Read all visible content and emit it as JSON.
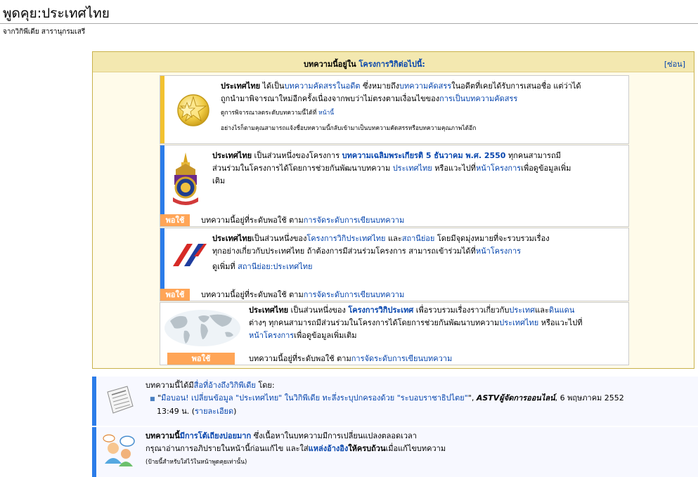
{
  "page": {
    "title": "พูดคุย:ประเทศไทย",
    "tagline": "จากวิกิพีเดีย สารานุกรมเสรี"
  },
  "projects": {
    "header_prefix": "บทความนี้อยู่ใน ",
    "header_link": "โครงการวิกิต่อไปนี้:",
    "hide_label": "[ซ่อน]"
  },
  "former_fa": {
    "subject": "ประเทศไทย",
    "t1": " ได้เป็น",
    "l1": "บทความคัดสรรในอดีต",
    "t2": " ซึ่งหมายถึง",
    "l2": "บทความคัดสรร",
    "t3": "ในอดีตที่เคยได้รับการเสนอชื่อ แต่ว่าได้",
    "line2_text": "ถูกนำมาพิจารณาใหม่อีกครั้งเนื่องจากพบว่าไม่ตรงตามเงื่อนไขของ",
    "line2_link": "การเป็นบทความคัดสรร",
    "note1_text": "ดูการพิจารณาลดระดับบทความนี้ได้ที่ ",
    "note1_link": "หน้านี้",
    "note2": "อย่างไรก็ตามคุณสามารถแจ้งชื่อบทความนี้กลับเข้ามาเป็นบทความคัดสรรหรือบทความคุณภาพได้อีก"
  },
  "king_project": {
    "subject": "ประเทศไทย",
    "t1": " เป็นส่วนหนึ่งของโครงการ ",
    "l1": "บทความเฉลิมพระเกียรติ 5 ธันวาคม พ.ศ. 2550",
    "t2": " ทุกคนสามารถมี",
    "line2_t": "ส่วนร่วมในโครงการได้โดยการช่วยกันพัฒนาบทความ ",
    "line2_l": "ประเทศไทย",
    "line2_t2": " หรือแวะไปที่",
    "line2_l2": "หน้าโครงการ",
    "line2_t3": "เพื่อดูข้อมูลเพิ่ม",
    "line3": "เติม",
    "rating": "พอใช้",
    "rating_t": "บทความนี้อยู่ที่ระดับพอใช้ ตาม",
    "rating_l": "การจัดระดับการเขียนบทความ"
  },
  "thai_project": {
    "subject": "ประเทศไทย",
    "t1": "เป็นส่วนหนึ่งของ",
    "l1": "โครงการวิกิประเทศไทย",
    "t2": " และ",
    "l2": "สถานีย่อย",
    "t3": " โดยมีจุดมุ่งหมายที่จะรวบรวมเรื่อง",
    "line2_t": "ทุกอย่างเกี่ยวกับประเทศไทย ถ้าต้องการมีส่วนร่วมโครงการ สามารถเข้าร่วมได้ที่",
    "line2_l": "หน้าโครงการ",
    "line3_t": "ดูเพิ่มที่ ",
    "line3_l": "สถานีย่อย:ประเทศไทย",
    "rating": "พอใช้",
    "rating_t": "บทความนี้อยู่ที่ระดับพอใช้ ตาม",
    "rating_l": "การจัดระดับการเขียนบทความ"
  },
  "country_project": {
    "subject": "ประเทศไทย",
    "t1": " เป็นส่วนหนึ่งของ ",
    "l1": "โครงการวิกิประเทศ",
    "t2": " เพื่อรวบรวมเรื่องราวเกี่ยวกับ",
    "l2": "ประเทศ",
    "t3": "และ",
    "l3": "ดินแดน",
    "line2_t": "ต่างๆ ทุกคนสามารถมีส่วนร่วมในโครงการได้โดยการช่วยกันพัฒนาบทความ",
    "line2_l": "ประเทศไทย",
    "line2_t2": " หรือแวะไปที่",
    "line3_l": "หน้าโครงการ",
    "line3_t": "เพื่อดูข้อมูลเพิ่มเติม",
    "rating": "พอใช้",
    "rating_t": "บทความนี้อยู่ที่ระดับพอใช้ ตาม",
    "rating_l": "การจัดระดับการเขียนบทความ"
  },
  "media": {
    "t1": "บทความนี้ได้มี",
    "l1": "สื่อที่อ้างถึงวิกิพีเดีย",
    "t2": " โดย:",
    "bullet": "■",
    "q1": "\"",
    "l2": "มือบอน! เปลี่ยนข้อมูล \"ประเทศไทย\" ในวิกิพีเดีย ทะลึ่งระบุปกครองด้วย \"ระบอบราชาธิปไตย\"",
    "q2": "\", ",
    "source": "ASTVผู้จัดการออนไลน์",
    "date": ", 6 พฤษภาคม 2552",
    "time": "13:49 น. (",
    "l3": "รายละเอียด",
    "close": ")"
  },
  "controversy": {
    "t1": "บทความนี้",
    "l1": "มีการโต้เถียงบ่อยมาก",
    "t2": " ซึ่งเนื้อหาในบทความมีการเปลี่ยนแปลงตลอดเวลา",
    "line2_t": "กรุณาอ่านการอภิปรายในหน้านี้ก่อนแก้ไข และใส่",
    "line2_l": "แหล่งอ้างอิง",
    "line2_b": "ให้ครบถ้วน",
    "line2_t2": "เมื่อแก้ไขบทความ",
    "line3": "(ป้ายนี้สำหรับใส่ไว้ในหน้าพูดคุยเท่านั้น)"
  },
  "colors": {
    "star_bar": "#f2c230",
    "blue_bar": "#2b7ce9",
    "rating": "#ffa557",
    "link": "#0645ad"
  }
}
